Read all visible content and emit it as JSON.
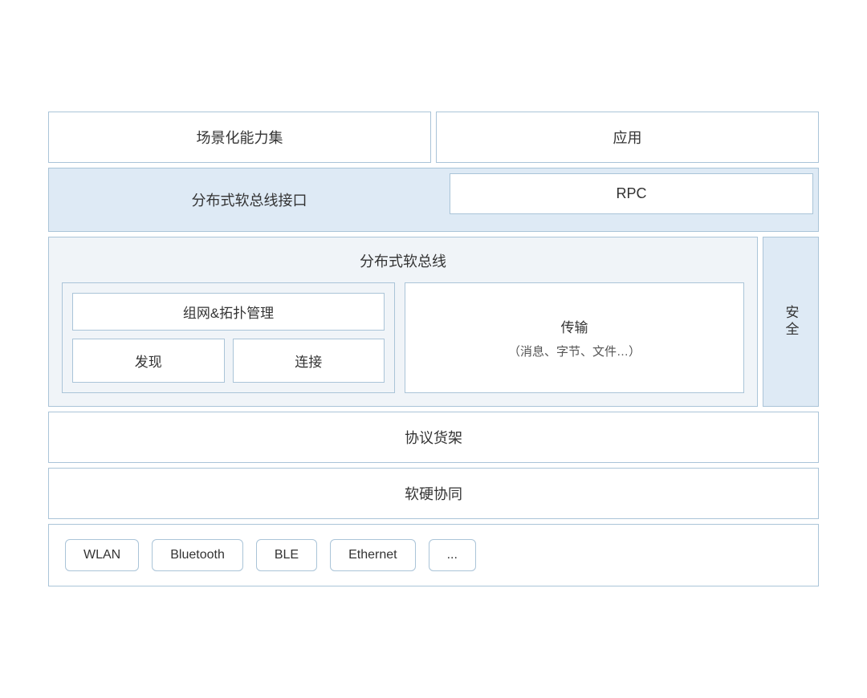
{
  "diagram": {
    "top": {
      "scene": "场景化能力集",
      "app": "应用"
    },
    "second": {
      "bus_interface": "分布式软总线接口",
      "rpc": "RPC"
    },
    "dist_bus": {
      "title": "分布式软总线",
      "network": {
        "title": "组网&拓扑管理",
        "discover": "发现",
        "connect": "连接"
      },
      "transport": {
        "title": "传输",
        "subtitle": "（消息、字节、文件…）"
      },
      "security": "安全"
    },
    "protocol": "协议货架",
    "sw_hw": "软硬协同",
    "chips": {
      "items": [
        "WLAN",
        "Bluetooth",
        "BLE",
        "Ethernet",
        "..."
      ]
    }
  }
}
